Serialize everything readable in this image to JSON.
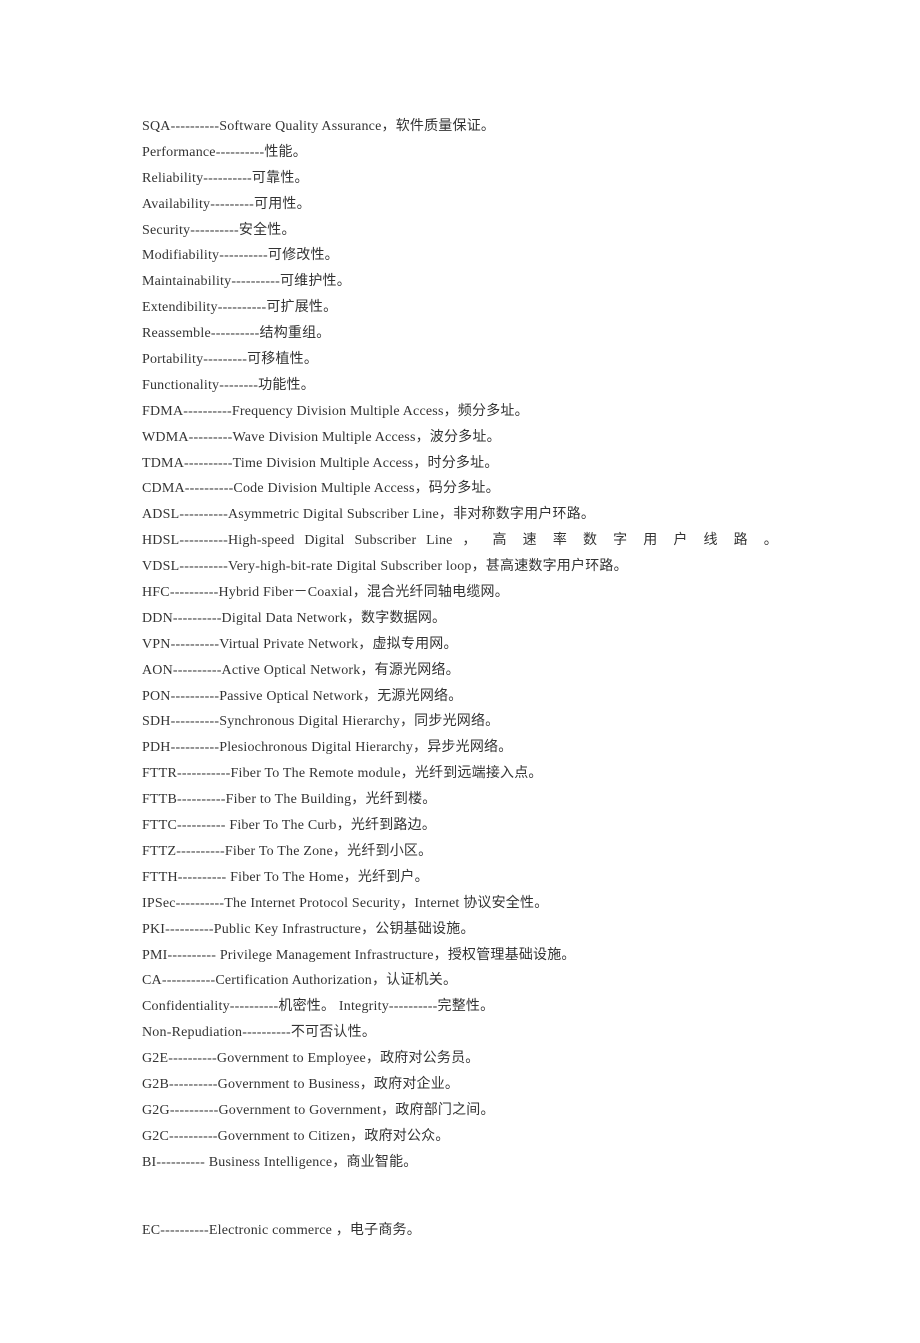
{
  "entries": [
    {
      "text": "SQA----------Software Quality Assurance，软件质量保证。"
    },
    {
      "text": "Performance----------性能。"
    },
    {
      "text": "Reliability----------可靠性。"
    },
    {
      "text": "Availability---------可用性。"
    },
    {
      "text": "Security----------安全性。"
    },
    {
      "text": "Modifiability----------可修改性。"
    },
    {
      "text": "Maintainability----------可维护性。"
    },
    {
      "text": "Extendibility----------可扩展性。"
    },
    {
      "text": "Reassemble----------结构重组。"
    },
    {
      "text": "Portability---------可移植性。"
    },
    {
      "text": "Functionality--------功能性。"
    },
    {
      "text": "FDMA----------Frequency Division Multiple Access，频分多址。"
    },
    {
      "text": "WDMA---------Wave Division Multiple Access，波分多址。"
    },
    {
      "text": "TDMA----------Time Division Multiple Access，时分多址。"
    },
    {
      "text": "CDMA----------Code Division Multiple Access，码分多址。"
    },
    {
      "text": "ADSL----------Asymmetric Digital Subscriber Line，非对称数字用户环路。"
    },
    {
      "text": "HDSL----------High-speed Digital Subscriber Line ， 高 速 率 数 字 用 户 线 路 。",
      "justified": true
    },
    {
      "text": "VDSL----------Very-high-bit-rate Digital Subscriber loop，甚高速数字用户环路。"
    },
    {
      "text": "HFC----------Hybrid Fiber－Coaxial，混合光纤同轴电缆网。"
    },
    {
      "text": "DDN----------Digital Data Network，数字数据网。"
    },
    {
      "text": "VPN----------Virtual Private Network，虚拟专用网。"
    },
    {
      "text": "AON----------Active Optical Network，有源光网络。"
    },
    {
      "text": "PON----------Passive Optical Network，无源光网络。"
    },
    {
      "text": "SDH----------Synchronous Digital Hierarchy，同步光网络。"
    },
    {
      "text": "PDH----------Plesiochronous Digital Hierarchy，异步光网络。"
    },
    {
      "text": "FTTR-----------Fiber To The Remote module，光纤到远端接入点。"
    },
    {
      "text": "FTTB----------Fiber to The Building，光纤到楼。"
    },
    {
      "text": "FTTC---------- Fiber To The Curb，光纤到路边。"
    },
    {
      "text": "FTTZ----------Fiber To The Zone，光纤到小区。"
    },
    {
      "text": "FTTH---------- Fiber To The Home，光纤到户。"
    },
    {
      "text": "IPSec----------The Internet Protocol Security，Internet 协议安全性。"
    },
    {
      "text": "PKI----------Public Key Infrastructure，公钥基础设施。"
    },
    {
      "text": "PMI---------- Privilege Management Infrastructure，授权管理基础设施。"
    },
    {
      "text": "CA-----------Certification Authorization，认证机关。"
    },
    {
      "text": "Confidentiality----------机密性。 Integrity----------完整性。"
    },
    {
      "text": "Non-Repudiation----------不可否认性。"
    },
    {
      "text": "G2E----------Government to Employee，政府对公务员。"
    },
    {
      "text": "G2B----------Government to Business，政府对企业。"
    },
    {
      "text": "G2G----------Government to Government，政府部门之间。"
    },
    {
      "text": "G2C----------Government to Citizen，政府对公众。"
    },
    {
      "text": "BI---------- Business Intelligence，商业智能。"
    }
  ],
  "entries2": [
    {
      "text": "EC----------Electronic commerce ，电子商务。"
    }
  ]
}
